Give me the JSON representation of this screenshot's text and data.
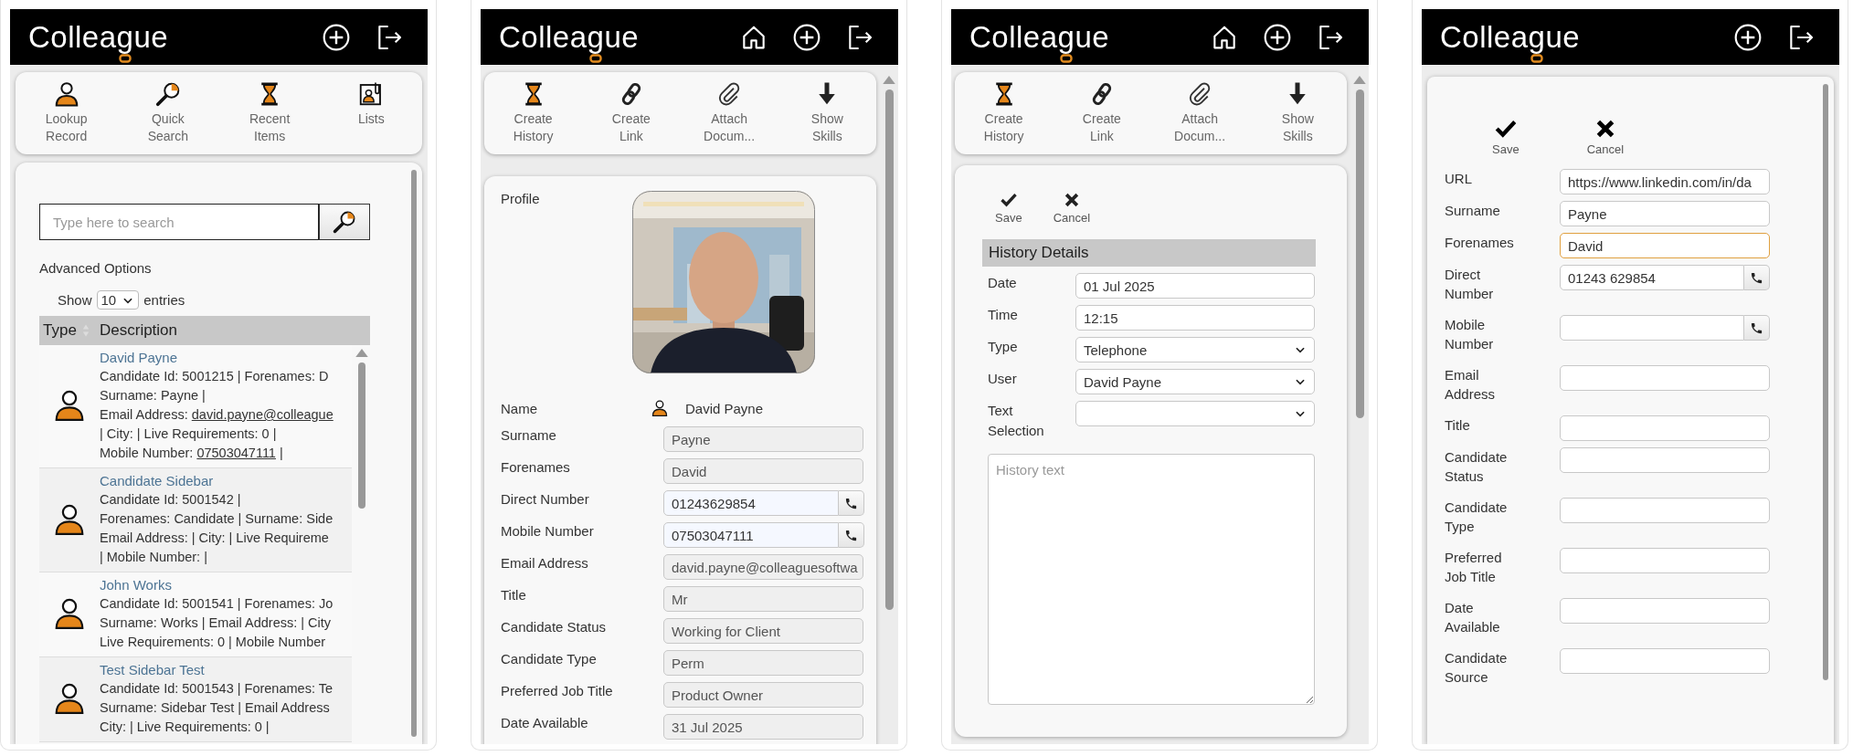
{
  "panels": [
    {
      "kind": "search",
      "header": {
        "logo": "Colleague"
      },
      "toolbar": [
        {
          "label": "Lookup Record"
        },
        {
          "label": "Quick Search"
        },
        {
          "label": "Recent Items"
        },
        {
          "label": "Lists"
        }
      ],
      "search": {
        "placeholder": "Type here to search"
      },
      "advanced_options": "Advanced Options",
      "show_entries": {
        "prefix": "Show",
        "value": "10",
        "suffix": "entries"
      },
      "table": {
        "columns": [
          "Type",
          "Description"
        ],
        "rows": [
          {
            "title": "David Payne",
            "lines": [
              [
                {
                  "text": "Candidate Id: 5001215 | Forenames: D"
                }
              ],
              [
                {
                  "text": "Surname: Payne |"
                }
              ],
              [
                {
                  "text": "Email Address: "
                },
                {
                  "text": "david.payne@colleague",
                  "link": true
                }
              ],
              [
                {
                  "text": "| City: | Live Requirements: 0 |"
                }
              ],
              [
                {
                  "text": "Mobile Number: "
                },
                {
                  "text": "07503047111",
                  "link": true
                },
                {
                  "text": " |"
                }
              ]
            ]
          },
          {
            "title": "Candidate Sidebar",
            "lines": [
              [
                {
                  "text": "Candidate Id: 5001542 |"
                }
              ],
              [
                {
                  "text": "Forenames: Candidate | Surname: Side"
                }
              ],
              [
                {
                  "text": "Email Address: | City: | Live Requireme"
                }
              ],
              [
                {
                  "text": "| Mobile Number: |"
                }
              ]
            ]
          },
          {
            "title": "John Works",
            "lines": [
              [
                {
                  "text": "Candidate Id: 5001541 | Forenames: Jo"
                }
              ],
              [
                {
                  "text": "Surname: Works | Email Address: | City"
                }
              ],
              [
                {
                  "text": "Live Requirements: 0 | Mobile Number"
                }
              ]
            ]
          },
          {
            "title": "Test Sidebar Test",
            "lines": [
              [
                {
                  "text": "Candidate Id: 5001543 | Forenames: Te"
                }
              ],
              [
                {
                  "text": "Surname: Sidebar Test | Email Address"
                }
              ],
              [
                {
                  "text": "City: | Live Requirements: 0 |"
                }
              ]
            ]
          }
        ]
      }
    },
    {
      "kind": "profile",
      "header": {
        "logo": "Colleague"
      },
      "toolbar": [
        {
          "label": "Create History"
        },
        {
          "label": "Create Link"
        },
        {
          "label": "Attach Docum..."
        },
        {
          "label": "Show Skills"
        }
      ],
      "profile_label": "Profile",
      "name": {
        "label": "Name",
        "value": "David Payne"
      },
      "fields": [
        {
          "label": "Surname",
          "value": "Payne",
          "kind": "readonly"
        },
        {
          "label": "Forenames",
          "value": "David",
          "kind": "readonly"
        },
        {
          "label": "Direct Number",
          "value": "01243629854",
          "kind": "phone"
        },
        {
          "label": "Mobile Number",
          "value": "07503047111",
          "kind": "phone"
        },
        {
          "label": "Email Address",
          "value": "david.payne@colleaguesoftwa",
          "kind": "readonly"
        },
        {
          "label": "Title",
          "value": "Mr",
          "kind": "readonly"
        },
        {
          "label": "Candidate Status",
          "value": "Working for Client",
          "kind": "readonly"
        },
        {
          "label": "Candidate Type",
          "value": "Perm",
          "kind": "readonly"
        },
        {
          "label": "Preferred Job Title",
          "value": "Product Owner",
          "kind": "readonly"
        },
        {
          "label": "Date Available",
          "value": "31 Jul 2025",
          "kind": "readonly"
        }
      ]
    },
    {
      "kind": "history",
      "header": {
        "logo": "Colleague"
      },
      "toolbar": [
        {
          "label": "Create History"
        },
        {
          "label": "Create Link"
        },
        {
          "label": "Attach Docum..."
        },
        {
          "label": "Show Skills"
        }
      ],
      "actions": [
        {
          "label": "Save"
        },
        {
          "label": "Cancel"
        }
      ],
      "section_title": "History Details",
      "fields": [
        {
          "label": "Date",
          "value": "01 Jul 2025",
          "kind": "text"
        },
        {
          "label": "Time",
          "value": "12:15",
          "kind": "text"
        },
        {
          "label": "Type",
          "value": "Telephone",
          "kind": "select"
        },
        {
          "label": "User",
          "value": "David Payne",
          "kind": "select"
        },
        {
          "label": "Text Selection",
          "kind": "select"
        }
      ],
      "history_text": {
        "placeholder": "History text"
      }
    },
    {
      "kind": "edit",
      "header": {
        "logo": "Colleague"
      },
      "actions": [
        {
          "label": "Save"
        },
        {
          "label": "Cancel"
        }
      ],
      "fields": [
        {
          "label": "URL",
          "value": "https://www.linkedin.com/in/da",
          "kind": "text",
          "focused": false
        },
        {
          "label": "Surname",
          "value": "Payne",
          "kind": "text",
          "focused": false
        },
        {
          "label": "Forenames",
          "value": "David",
          "kind": "text",
          "focused": true
        },
        {
          "label": "Direct Number",
          "value": "01243 629854",
          "kind": "phone",
          "focused": false
        },
        {
          "label": "Mobile Number",
          "kind": "phone",
          "focused": false
        },
        {
          "label": "Email Address",
          "kind": "text",
          "focused": false
        },
        {
          "label": "Title",
          "kind": "text",
          "focused": false
        },
        {
          "label": "Candidate Status",
          "kind": "text",
          "focused": false
        },
        {
          "label": "Candidate Type",
          "kind": "text",
          "focused": false
        },
        {
          "label": "Preferred Job Title",
          "kind": "text",
          "focused": false
        },
        {
          "label": "Date Available",
          "kind": "text",
          "focused": false
        },
        {
          "label": "Candidate Source",
          "kind": "text",
          "focused": false
        }
      ]
    }
  ]
}
